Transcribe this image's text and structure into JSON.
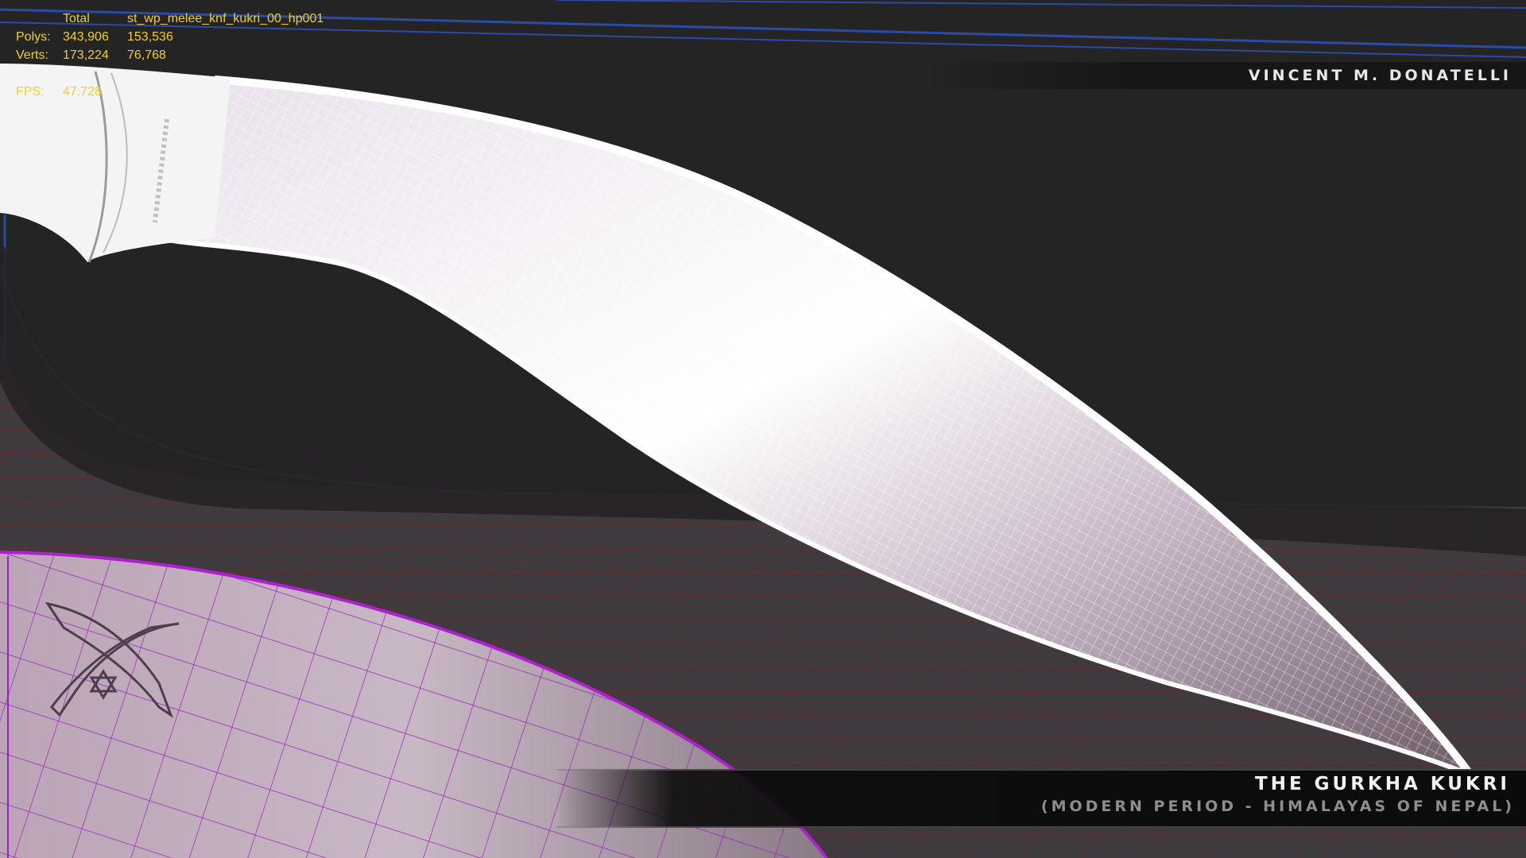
{
  "stats": {
    "header": {
      "label": "",
      "total": "Total",
      "object": "st_wp_melee_knf_kukri_00_hp001"
    },
    "polys": {
      "label": "Polys:",
      "total": "343,906",
      "object": "153,536"
    },
    "verts": {
      "label": "Verts:",
      "total": "173,224",
      "object": "76,768"
    },
    "fps": {
      "label": "FPS:",
      "value": "47.728"
    }
  },
  "overlay": {
    "author": "VINCENT M. DONATELLI",
    "title": "THE GURKHA KUKRI",
    "subtitle": "(MODERN PERIOD - HIMALAYAS OF NEPAL)"
  },
  "colors": {
    "background": "#252425",
    "grid_line": "#7a2a2a",
    "blade_wire": "#ffffff",
    "sheath_wire": "#a020c0",
    "stats_text": "#f0d020",
    "viewport_border": "#2a4aa8"
  },
  "icons": {
    "emblem": "crossed-kukris-star-emblem-icon"
  }
}
